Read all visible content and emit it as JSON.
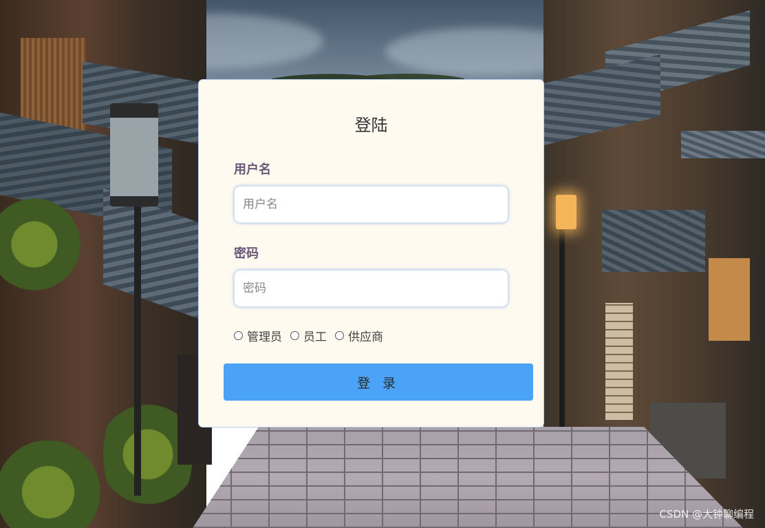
{
  "login": {
    "title": "登陆",
    "username_label": "用户名",
    "username_placeholder": "用户名",
    "password_label": "密码",
    "password_placeholder": "密码",
    "roles": [
      "管理员",
      "员工",
      "供应商"
    ],
    "submit_label": "登 录",
    "submit_color": "#4aa3f6",
    "card_color": "#fffaf0"
  },
  "watermark": "CSDN @大钟聊编程"
}
